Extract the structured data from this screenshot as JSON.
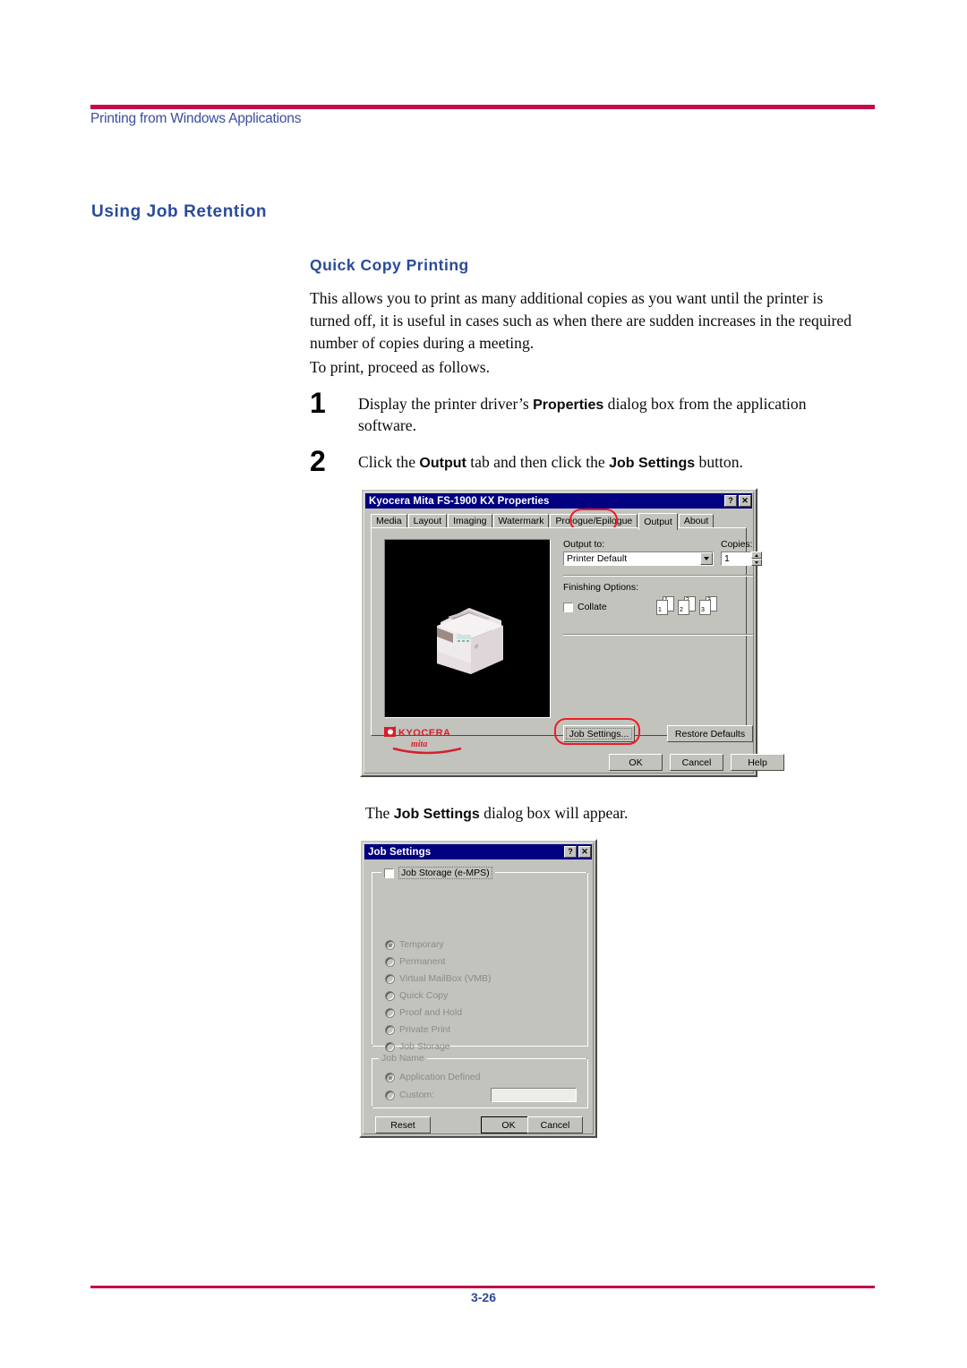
{
  "page": {
    "header_title": "Printing from Windows Applications",
    "footer_page": "3-26",
    "accent_rule_color": "#C30B49",
    "heading_color": "#2A4B9B"
  },
  "section": {
    "h1": "Using Job Retention",
    "h2": "Quick Copy Printing",
    "para1": "This allows you to print as many additional copies as you want until the printer is turned off, it is useful in cases such as when there are sudden increases in the required number of copies during a meeting.",
    "para2": "To print, proceed as follows.",
    "steps": [
      {
        "num": "1",
        "text_before": "Display the printer driver’s ",
        "bold": "Properties",
        "text_after": " dialog box from the application software."
      },
      {
        "num": "2",
        "text_before": "Click the ",
        "bold": "Output",
        "text_mid": " tab and then click the ",
        "bold2": "Job Settings",
        "text_after": " button."
      }
    ],
    "caption_before": "The ",
    "caption_bold": "Job Settings",
    "caption_after": " dialog box will appear."
  },
  "properties_dialog": {
    "title": "Kyocera Mita FS-1900 KX Properties",
    "titlebar_buttons": [
      "?",
      "✕"
    ],
    "tabs": [
      {
        "label": "Media",
        "active": false
      },
      {
        "label": "Layout",
        "active": false
      },
      {
        "label": "Imaging",
        "active": false
      },
      {
        "label": "Watermark",
        "active": false
      },
      {
        "label": "Prologue/Epilogue",
        "active": false
      },
      {
        "label": "Output",
        "active": true
      },
      {
        "label": "About",
        "active": false
      }
    ],
    "output_to_label": "Output to:",
    "output_to_value": "Printer Default",
    "copies_label": "Copies:",
    "copies_value": "1",
    "finishing_label": "Finishing Options:",
    "collate_label": "Collate",
    "collate_checked": false,
    "collate_stack_numbers": [
      "1",
      "2",
      "3"
    ],
    "logo_brand": "KYOCERA",
    "logo_sub": "mita",
    "job_settings_button": "Job Settings...",
    "restore_defaults_button": "Restore Defaults",
    "ok_button": "OK",
    "cancel_button": "Cancel",
    "help_button": "Help",
    "highlight_color": "#EE1C25"
  },
  "job_settings_dialog": {
    "title": "Job Settings",
    "titlebar_buttons": [
      "?",
      "✕"
    ],
    "group_job_storage_label": "Job Storage (e-MPS)",
    "job_storage_checked": false,
    "storage_options": [
      {
        "label": "Temporary",
        "selected": true
      },
      {
        "label": "Permanent",
        "selected": false
      },
      {
        "label": "Virtual MailBox (VMB)",
        "selected": false
      },
      {
        "label": "Quick Copy",
        "selected": false
      },
      {
        "label": "Proof and Hold",
        "selected": false
      },
      {
        "label": "Private Print",
        "selected": false
      },
      {
        "label": "Job Storage",
        "selected": false
      }
    ],
    "group_job_name_label": "Job Name",
    "job_name_options": [
      {
        "label": "Application Defined",
        "selected": true
      },
      {
        "label": "Custom:",
        "selected": false
      }
    ],
    "custom_value": "",
    "reset_button": "Reset",
    "ok_button": "OK",
    "cancel_button": "Cancel"
  }
}
